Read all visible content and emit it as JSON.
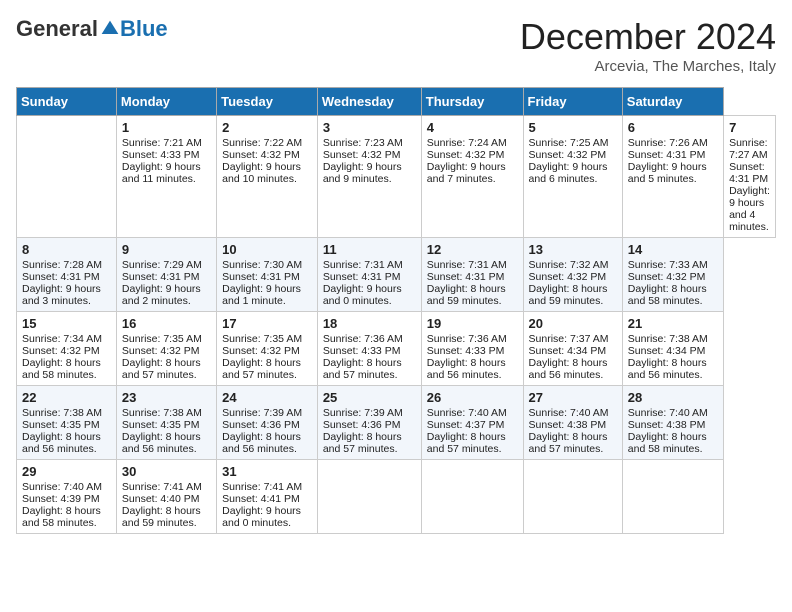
{
  "header": {
    "logo_general": "General",
    "logo_blue": "Blue",
    "month_title": "December 2024",
    "subtitle": "Arcevia, The Marches, Italy"
  },
  "calendar": {
    "days_of_week": [
      "Sunday",
      "Monday",
      "Tuesday",
      "Wednesday",
      "Thursday",
      "Friday",
      "Saturday"
    ],
    "weeks": [
      [
        null,
        {
          "day": "1",
          "sunrise": "Sunrise: 7:21 AM",
          "sunset": "Sunset: 4:33 PM",
          "daylight": "Daylight: 9 hours and 11 minutes."
        },
        {
          "day": "2",
          "sunrise": "Sunrise: 7:22 AM",
          "sunset": "Sunset: 4:32 PM",
          "daylight": "Daylight: 9 hours and 10 minutes."
        },
        {
          "day": "3",
          "sunrise": "Sunrise: 7:23 AM",
          "sunset": "Sunset: 4:32 PM",
          "daylight": "Daylight: 9 hours and 9 minutes."
        },
        {
          "day": "4",
          "sunrise": "Sunrise: 7:24 AM",
          "sunset": "Sunset: 4:32 PM",
          "daylight": "Daylight: 9 hours and 7 minutes."
        },
        {
          "day": "5",
          "sunrise": "Sunrise: 7:25 AM",
          "sunset": "Sunset: 4:32 PM",
          "daylight": "Daylight: 9 hours and 6 minutes."
        },
        {
          "day": "6",
          "sunrise": "Sunrise: 7:26 AM",
          "sunset": "Sunset: 4:31 PM",
          "daylight": "Daylight: 9 hours and 5 minutes."
        },
        {
          "day": "7",
          "sunrise": "Sunrise: 7:27 AM",
          "sunset": "Sunset: 4:31 PM",
          "daylight": "Daylight: 9 hours and 4 minutes."
        }
      ],
      [
        {
          "day": "8",
          "sunrise": "Sunrise: 7:28 AM",
          "sunset": "Sunset: 4:31 PM",
          "daylight": "Daylight: 9 hours and 3 minutes."
        },
        {
          "day": "9",
          "sunrise": "Sunrise: 7:29 AM",
          "sunset": "Sunset: 4:31 PM",
          "daylight": "Daylight: 9 hours and 2 minutes."
        },
        {
          "day": "10",
          "sunrise": "Sunrise: 7:30 AM",
          "sunset": "Sunset: 4:31 PM",
          "daylight": "Daylight: 9 hours and 1 minute."
        },
        {
          "day": "11",
          "sunrise": "Sunrise: 7:31 AM",
          "sunset": "Sunset: 4:31 PM",
          "daylight": "Daylight: 9 hours and 0 minutes."
        },
        {
          "day": "12",
          "sunrise": "Sunrise: 7:31 AM",
          "sunset": "Sunset: 4:31 PM",
          "daylight": "Daylight: 8 hours and 59 minutes."
        },
        {
          "day": "13",
          "sunrise": "Sunrise: 7:32 AM",
          "sunset": "Sunset: 4:32 PM",
          "daylight": "Daylight: 8 hours and 59 minutes."
        },
        {
          "day": "14",
          "sunrise": "Sunrise: 7:33 AM",
          "sunset": "Sunset: 4:32 PM",
          "daylight": "Daylight: 8 hours and 58 minutes."
        }
      ],
      [
        {
          "day": "15",
          "sunrise": "Sunrise: 7:34 AM",
          "sunset": "Sunset: 4:32 PM",
          "daylight": "Daylight: 8 hours and 58 minutes."
        },
        {
          "day": "16",
          "sunrise": "Sunrise: 7:35 AM",
          "sunset": "Sunset: 4:32 PM",
          "daylight": "Daylight: 8 hours and 57 minutes."
        },
        {
          "day": "17",
          "sunrise": "Sunrise: 7:35 AM",
          "sunset": "Sunset: 4:32 PM",
          "daylight": "Daylight: 8 hours and 57 minutes."
        },
        {
          "day": "18",
          "sunrise": "Sunrise: 7:36 AM",
          "sunset": "Sunset: 4:33 PM",
          "daylight": "Daylight: 8 hours and 57 minutes."
        },
        {
          "day": "19",
          "sunrise": "Sunrise: 7:36 AM",
          "sunset": "Sunset: 4:33 PM",
          "daylight": "Daylight: 8 hours and 56 minutes."
        },
        {
          "day": "20",
          "sunrise": "Sunrise: 7:37 AM",
          "sunset": "Sunset: 4:34 PM",
          "daylight": "Daylight: 8 hours and 56 minutes."
        },
        {
          "day": "21",
          "sunrise": "Sunrise: 7:38 AM",
          "sunset": "Sunset: 4:34 PM",
          "daylight": "Daylight: 8 hours and 56 minutes."
        }
      ],
      [
        {
          "day": "22",
          "sunrise": "Sunrise: 7:38 AM",
          "sunset": "Sunset: 4:35 PM",
          "daylight": "Daylight: 8 hours and 56 minutes."
        },
        {
          "day": "23",
          "sunrise": "Sunrise: 7:38 AM",
          "sunset": "Sunset: 4:35 PM",
          "daylight": "Daylight: 8 hours and 56 minutes."
        },
        {
          "day": "24",
          "sunrise": "Sunrise: 7:39 AM",
          "sunset": "Sunset: 4:36 PM",
          "daylight": "Daylight: 8 hours and 56 minutes."
        },
        {
          "day": "25",
          "sunrise": "Sunrise: 7:39 AM",
          "sunset": "Sunset: 4:36 PM",
          "daylight": "Daylight: 8 hours and 57 minutes."
        },
        {
          "day": "26",
          "sunrise": "Sunrise: 7:40 AM",
          "sunset": "Sunset: 4:37 PM",
          "daylight": "Daylight: 8 hours and 57 minutes."
        },
        {
          "day": "27",
          "sunrise": "Sunrise: 7:40 AM",
          "sunset": "Sunset: 4:38 PM",
          "daylight": "Daylight: 8 hours and 57 minutes."
        },
        {
          "day": "28",
          "sunrise": "Sunrise: 7:40 AM",
          "sunset": "Sunset: 4:38 PM",
          "daylight": "Daylight: 8 hours and 58 minutes."
        }
      ],
      [
        {
          "day": "29",
          "sunrise": "Sunrise: 7:40 AM",
          "sunset": "Sunset: 4:39 PM",
          "daylight": "Daylight: 8 hours and 58 minutes."
        },
        {
          "day": "30",
          "sunrise": "Sunrise: 7:41 AM",
          "sunset": "Sunset: 4:40 PM",
          "daylight": "Daylight: 8 hours and 59 minutes."
        },
        {
          "day": "31",
          "sunrise": "Sunrise: 7:41 AM",
          "sunset": "Sunset: 4:41 PM",
          "daylight": "Daylight: 9 hours and 0 minutes."
        },
        null,
        null,
        null,
        null
      ]
    ]
  }
}
